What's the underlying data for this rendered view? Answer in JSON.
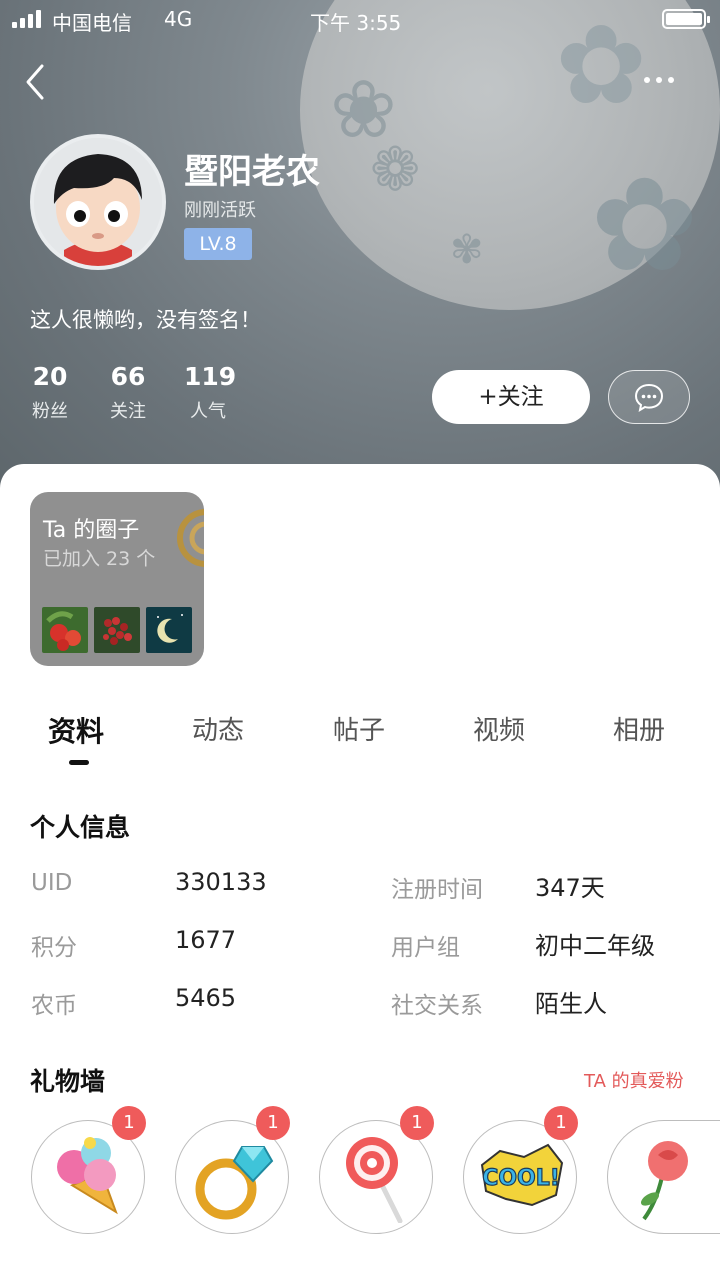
{
  "status_bar": {
    "carrier": "中国电信",
    "network": "4G",
    "time": "下午 3:55"
  },
  "profile": {
    "username": "暨阳老农",
    "active_status": "刚刚活跃",
    "level": "LV.8",
    "signature": "这人很懒哟，没有签名！",
    "stats": [
      {
        "value": "20",
        "label": "粉丝"
      },
      {
        "value": "66",
        "label": "关注"
      },
      {
        "value": "119",
        "label": "人气"
      }
    ],
    "follow_label": "+关注"
  },
  "circle": {
    "title": "Ta 的圈子",
    "subtitle": "已加入 23 个"
  },
  "tabs": [
    "资料",
    "动态",
    "帖子",
    "视频",
    "相册"
  ],
  "info": {
    "title": "个人信息",
    "rows": [
      {
        "label": "UID",
        "value": "330133"
      },
      {
        "label": "积分",
        "value": "1677"
      },
      {
        "label": "农币",
        "value": "5465"
      },
      {
        "label": "注册时间",
        "value": "347天"
      },
      {
        "label": "用户组",
        "value": "初中二年级"
      },
      {
        "label": "社交关系",
        "value": "陌生人"
      }
    ]
  },
  "gifts": {
    "title": "礼物墙",
    "link": "TA 的真爱粉",
    "items": [
      {
        "icon": "ice-cream-icon",
        "count": "1"
      },
      {
        "icon": "diamond-ring-icon",
        "count": "1"
      },
      {
        "icon": "lollipop-icon",
        "count": "1"
      },
      {
        "icon": "cool-sticker-icon",
        "count": "1"
      },
      {
        "icon": "rose-icon",
        "count": ""
      }
    ]
  },
  "colors": {
    "accent_red": "#ef5b5b",
    "level_blue": "#8eb3e8"
  }
}
